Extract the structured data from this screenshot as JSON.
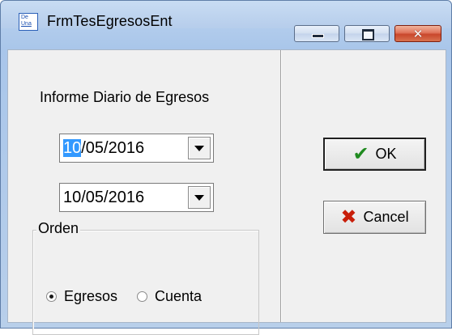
{
  "window": {
    "title": "FrmTesEgresosEnt",
    "icon": {
      "name": "app-icon",
      "text_top": "De",
      "text_bottom": "Una"
    }
  },
  "form": {
    "report_label": "Informe Diario de Egresos",
    "date_from": {
      "highlighted": "10",
      "rest": "/05/2016"
    },
    "date_to": "10/05/2016",
    "order": {
      "legend": "Orden",
      "options": [
        {
          "label": "Egresos",
          "selected": true
        },
        {
          "label": "Cuenta",
          "selected": false
        }
      ]
    }
  },
  "actions": {
    "ok_label": "OK",
    "cancel_label": "Cancel",
    "ok_icon": "check-icon",
    "cancel_icon": "cross-icon"
  },
  "colors": {
    "ok_check": "#1f8a1f",
    "cancel_cross": "#c81e0a",
    "selection": "#3399ff"
  }
}
